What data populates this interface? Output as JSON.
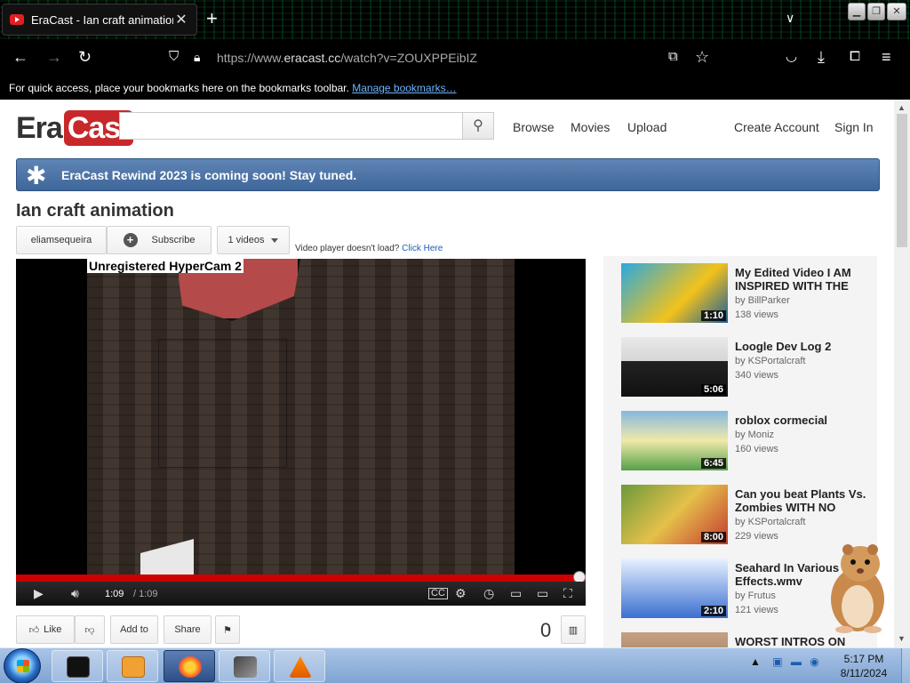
{
  "browser": {
    "tab_title": "EraCast - Ian craft animation",
    "new_tab": "+",
    "tab_close": "✕",
    "tab_list": "∨",
    "url_scheme": "https://www.",
    "url_host": "eracast.cc",
    "url_path": "/watch?v=ZOUXPPEibIZ",
    "bookmarks_text": "For quick access, place your bookmarks here on the bookmarks toolbar.",
    "bookmarks_link": "Manage bookmarks…"
  },
  "site": {
    "logo_era": "Era",
    "logo_cast": "Cast",
    "search_placeholder": "",
    "nav": {
      "browse": "Browse",
      "movies": "Movies",
      "upload": "Upload",
      "create_account": "Create Account",
      "sign_in": "Sign In"
    },
    "banner": "EraCast Rewind 2023 is coming soon! Stay tuned."
  },
  "video": {
    "title": "Ian craft animation",
    "channel": "eliamsequeira",
    "subscribe": "Subscribe",
    "videos_count": "1 videos",
    "noload_text": "Video player doesn't load?",
    "noload_link": "Click Here",
    "watermark": "Unregistered HyperCam 2",
    "current_time": "1:09",
    "duration": "/ 1:09",
    "progress_fraction": 1.0,
    "like": "Like",
    "add_to": "Add to",
    "share": "Share",
    "views": "0"
  },
  "related": [
    {
      "title": "My Edited Video I AM INSPIRED WITH THE",
      "by": "by BillParker",
      "views": "138 views",
      "duration": "1:10"
    },
    {
      "title": "Loogle Dev Log 2",
      "by": "by KSPortalcraft",
      "views": "340 views",
      "duration": "5:06"
    },
    {
      "title": "roblox cormecial",
      "by": "by Moniz",
      "views": "160 views",
      "duration": "6:45"
    },
    {
      "title": "Can you beat Plants Vs. Zombies WITH NO",
      "by": "by KSPortalcraft",
      "views": "229 views",
      "duration": "8:00"
    },
    {
      "title": "Seahard In Various Effects.wmv",
      "by": "by Frutus",
      "views": "121 views",
      "duration": "2:10"
    },
    {
      "title": "WORST INTROS ON",
      "by": "",
      "views": "",
      "duration": ""
    }
  ],
  "taskbar": {
    "time": "5:17 PM",
    "date": "8/11/2024"
  }
}
